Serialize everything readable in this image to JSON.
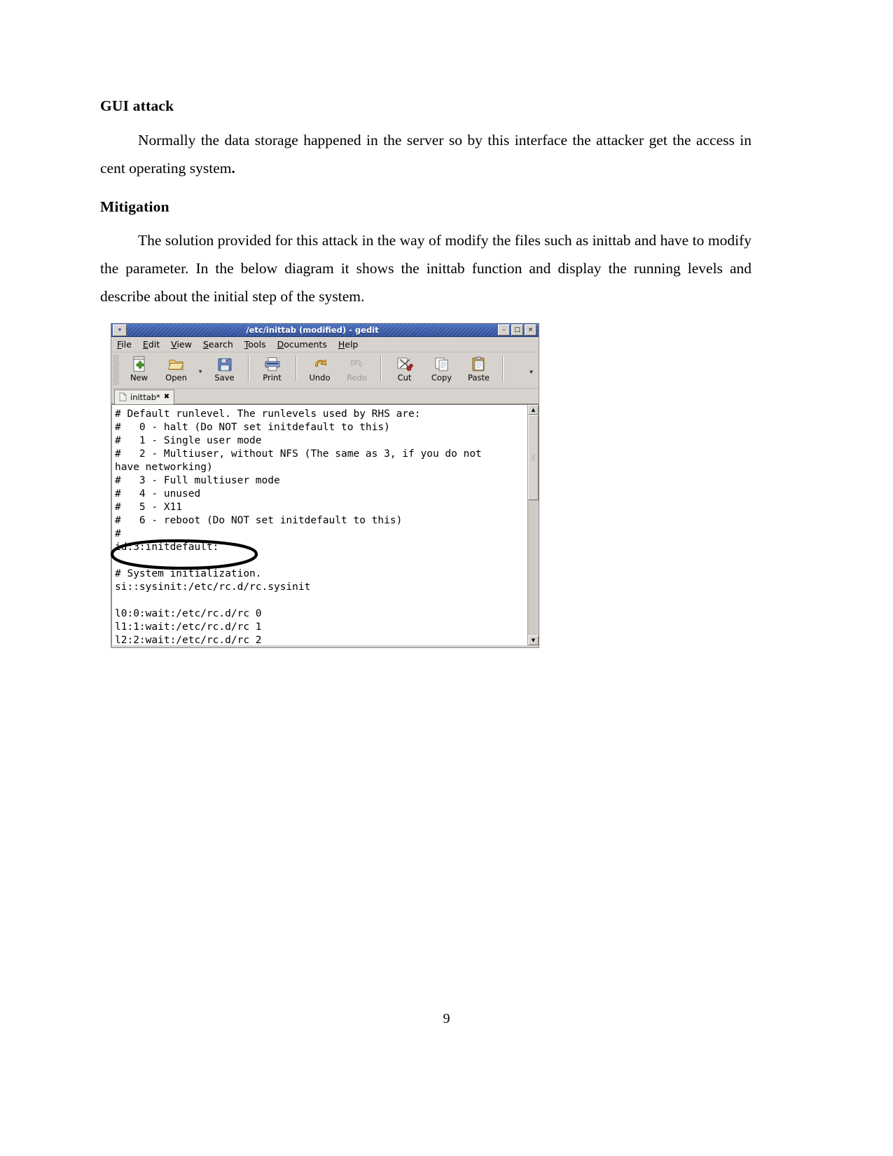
{
  "document": {
    "section1_heading": "GUI attack",
    "section1_para": "Normally the data storage happened in the server so by this interface the attacker get the access in cent operating system",
    "section1_para_end": ".",
    "section2_heading": "Mitigation",
    "section2_para": "The solution provided for this attack in the way of modify the files such as inittab and have to modify the parameter. In the below diagram it shows the inittab function and display the running levels and describe about the initial step of the system.",
    "page_number": "9"
  },
  "gedit": {
    "title": "/etc/inittab (modified) - gedit",
    "window_menu_icon": "chevron-down-icon",
    "window_controls": {
      "minimize": "–",
      "maximize": "□",
      "close": "×"
    },
    "menubar": [
      {
        "label": "File",
        "accel": "F"
      },
      {
        "label": "Edit",
        "accel": "E"
      },
      {
        "label": "View",
        "accel": "V"
      },
      {
        "label": "Search",
        "accel": "S"
      },
      {
        "label": "Tools",
        "accel": "T"
      },
      {
        "label": "Documents",
        "accel": "D"
      },
      {
        "label": "Help",
        "accel": "H"
      }
    ],
    "toolbar": [
      {
        "label": "New",
        "icon": "new-document-icon",
        "disabled": false
      },
      {
        "label": "Open",
        "icon": "open-folder-icon",
        "disabled": false
      },
      {
        "label": "Save",
        "icon": "floppy-disk-save-icon",
        "disabled": false
      },
      {
        "label": "Print",
        "icon": "printer-icon",
        "disabled": false
      },
      {
        "label": "Undo",
        "icon": "undo-arrow-icon",
        "disabled": false
      },
      {
        "label": "Redo",
        "icon": "redo-arrow-icon",
        "disabled": true
      },
      {
        "label": "Cut",
        "icon": "scissors-cut-icon",
        "disabled": false
      },
      {
        "label": "Copy",
        "icon": "copy-pages-icon",
        "disabled": false
      },
      {
        "label": "Paste",
        "icon": "clipboard-paste-icon",
        "disabled": false
      }
    ],
    "toolbar_open_dropdown": "chevron-down-icon",
    "toolbar_overflow": "chevron-down-icon",
    "tab": {
      "label": "inittab*",
      "close": "✖",
      "icon": "text-file-icon"
    },
    "editor_content": "# Default runlevel. The runlevels used by RHS are:\n#   0 - halt (Do NOT set initdefault to this)\n#   1 - Single user mode\n#   2 - Multiuser, without NFS (The same as 3, if you do not\nhave networking)\n#   3 - Full multiuser mode\n#   4 - unused\n#   5 - X11\n#   6 - reboot (Do NOT set initdefault to this)\n#\nid:3:initdefault:\n\n# System initialization.\nsi::sysinit:/etc/rc.d/rc.sysinit\n\nl0:0:wait:/etc/rc.d/rc 0\nl1:1:wait:/etc/rc.d/rc 1\nl2:2:wait:/etc/rc.d/rc 2",
    "scrollbar": {
      "up_arrow": "▲",
      "down_arrow": "▼"
    },
    "annotation": {
      "type": "hand-drawn-ellipse",
      "targets_line": "id:3:initdefault:",
      "color": "#000000"
    }
  },
  "colors": {
    "titlebar_blue": "#3a5ca8",
    "chrome_gray": "#d6d3ce",
    "editor_background": "#ffffff",
    "text": "#000000",
    "disabled_text": "#9a9a9a"
  }
}
